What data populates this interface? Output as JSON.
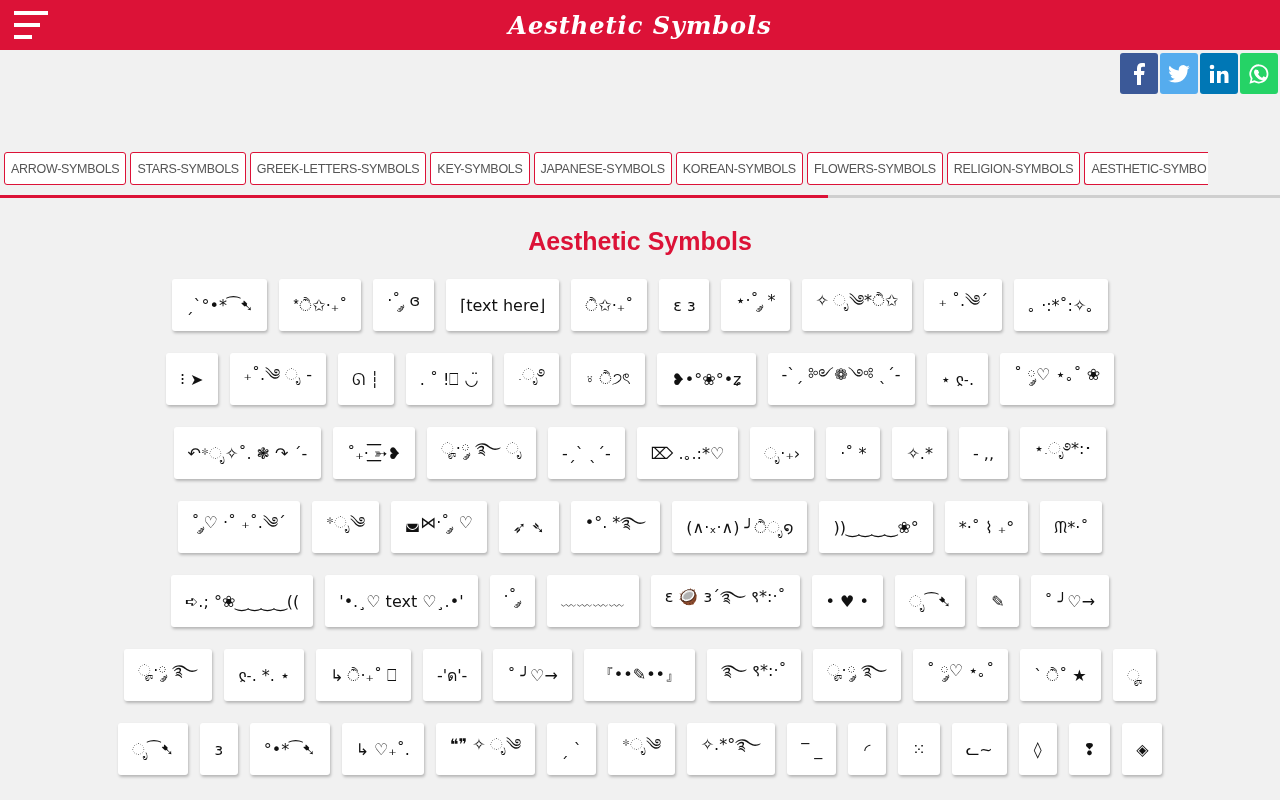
{
  "header": {
    "title": "Aesthetic Symbols"
  },
  "share_buttons": [
    {
      "kind": "facebook",
      "color": "#3b5998"
    },
    {
      "kind": "twitter",
      "color": "#55acee"
    },
    {
      "kind": "linkedin",
      "color": "#0077b5"
    },
    {
      "kind": "whatsapp",
      "color": "#25d366"
    }
  ],
  "tabs": [
    "ARROW-SYMBOLS",
    "STARS-SYMBOLS",
    "GREEK-LETTERS-SYMBOLS",
    "KEY-SYMBOLS",
    "JAPANESE-SYMBOLS",
    "KOREAN-SYMBOLS",
    "FLOWERS-SYMBOLS",
    "RELIGION-SYMBOLS",
    "AESTHETIC-SYMBO"
  ],
  "heading": "Aesthetic Symbols",
  "symbol_rows": [
    [
      "ˏˋ°•*⁀➷",
      "*ੈ✩‧₊˚",
      "·˚ ༘ ɞ",
      "⌈text here⌋",
      "ੈ✩‧₊˚",
      "ɛ ɜ",
      "⋆·˚ ༘ *",
      "✧ ೃ༄*ੈ✩",
      "₊ ˚.༄ˊ",
      "｡ ·:*˚:✧｡"
    ],
    [
      "⁝ ➤",
      "₊˚.༄ ೃ -",
      "ᘏ ┆",
      ". ˚ !⎕ ◡̈",
      ".ೃ࿔",
      "⍤ ੈ੭ৎ",
      "❥•°❀°•ʑ",
      "-ˋˏ ༻❁༺ ˎˊ-",
      "⋆ ჺ˗.",
      "˚ ◌༘♡ ⋆｡˚ ❀"
    ],
    [
      "↶*ೃ✧˚. ❃ ↷ ˊ-",
      "˚₊· ͟͟͞͞➳❥",
      "ೄ·༘ ࿐ ೃ",
      "-ˏˋ ˎˊ-",
      "⌦ .｡.:*♡",
      "ೃ·₊›",
      "·˚ *",
      "✧.*",
      "- ,,",
      "⋆.ೃ࿔*:･"
    ],
    [
      "˚ ༘♡ ·˚ ₊˚.༄ˊ",
      "*ೃ༄",
      "◛⋈·˚ ༘ ♡",
      "➶ ➴",
      "•°. *࿐",
      "(∧·ₓ·∧) ╯ੈೃ໑",
      "))‿‿‿‿❀°",
      "*·˚ ⌇ ₊°",
      "ᙏ*·˚"
    ],
    [
      "➪.; °❀‿‿‿‿((",
      "'•.¸♡ text ♡¸.•'",
      "·˚ ༘",
      "﹏﹏﹏﹏",
      "ɛ 🥥 ɜ´࿐ ९*:·˚",
      "• ♥ •",
      "ೃ⁀➷",
      "✎",
      "˚ ╯♡→"
    ],
    [
      "ೄ·༘ ࿐",
      "ჺ˗. *. ⋆",
      "↳ ੈ‧₊˚ ⎕",
      "-'ด'-",
      "˚ ╯♡→",
      "『••✎••』",
      "࿐ ९*:·˚",
      "ೄ·༘ ࿐",
      "˚ ◌༘♡ ⋆｡˚",
      "ˋ ੈ˚ ★",
      "ೄ"
    ],
    [
      "ೃ⁀➷",
      "ɜ",
      "°•*⁀➷",
      "↳ ♡₊˚.",
      "❝❞ ✧ ೃ༄",
      "ˏ ˋ",
      "*ೃ༄",
      "✧.*°࿐",
      "‾ _",
      "◜",
      "⁙",
      "ᓚ~",
      "◊",
      "❢",
      "◈"
    ]
  ]
}
